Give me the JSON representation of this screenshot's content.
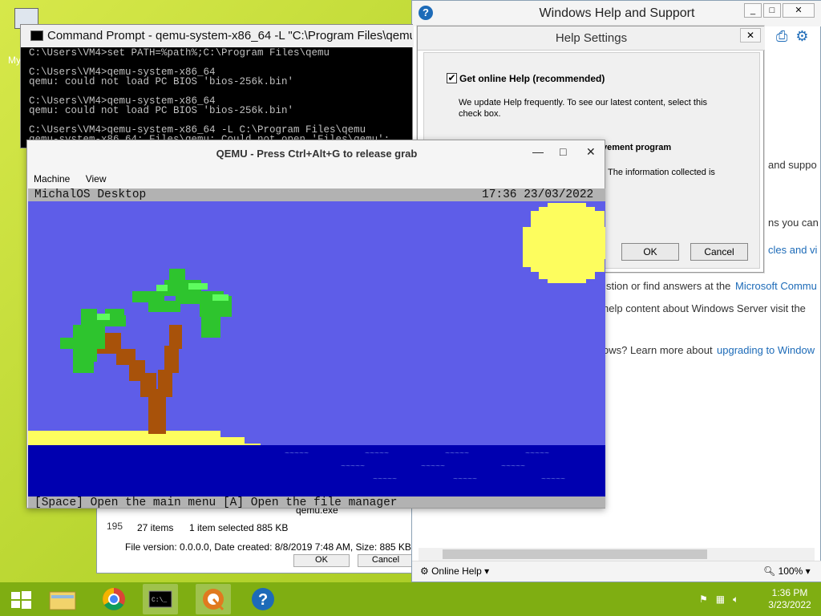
{
  "desktop": {
    "icon_label": "My C"
  },
  "explorer": {
    "partial_number": "195",
    "item_count": "27 items",
    "selection": "1 item selected  885 KB",
    "file_name": "qemu.exe",
    "file_info": "File version: 0.0.0.0, Date created: 8/8/2019 7:48 AM, Size: 885 KB",
    "ok_partial": "OK",
    "cancel_partial": "Cancel"
  },
  "help": {
    "title": "Windows Help and Support",
    "lines": [
      "and suppo",
      "ns you can",
      "cles and vi",
      "stion or find answers at the",
      "Microsoft Commu",
      "help content about Windows Server visit the",
      "ows? Learn more about",
      "upgrading to Window"
    ],
    "online_help": "Online Help",
    "zoom": "100%"
  },
  "settings": {
    "title": "Help Settings",
    "checkbox_label": "Get online Help (recommended)",
    "checkbox_checked": true,
    "description": "We update Help frequently. To see our latest content, select this check box.",
    "improvement_partial": "vement program",
    "collected_partial": "The information collected is",
    "ok": "OK",
    "cancel": "Cancel"
  },
  "cmd": {
    "title": "Command Prompt - qemu-system-x86_64  -L \"C:\\Program Files\\qemu",
    "output": "C:\\Users\\VM4>set PATH=%path%;C:\\Program Files\\qemu\n\nC:\\Users\\VM4>qemu-system-x86_64\nqemu: could not load PC BIOS 'bios-256k.bin'\n\nC:\\Users\\VM4>qemu-system-x86_64\nqemu: could not load PC BIOS 'bios-256k.bin'\n\nC:\\Users\\VM4>qemu-system-x86_64 -L C:\\Program Files\\qemu\nqemu-system-x86_64: Files\\qemu: Could not open 'Files\\qemu':"
  },
  "qemu": {
    "title": "QEMU - Press Ctrl+Alt+G to release grab",
    "menu": [
      "Machine",
      "View"
    ],
    "os_title": "MichalOS Desktop",
    "os_clock": "17:36 23/03/2022",
    "os_footer": "[Space] Open the main menu [A] Open the file manager",
    "waves": "~~~~~",
    "colors": {
      "sky": "#5e5de8",
      "sun": "#fdfd5e",
      "sand": "#fdfd5e",
      "sea": "#0000b0",
      "leaf": "#2ec42e",
      "leaf_light": "#5efc5e",
      "trunk": "#a8520a"
    }
  },
  "taskbar": {
    "time": "1:36 PM",
    "date": "3/23/2022"
  }
}
